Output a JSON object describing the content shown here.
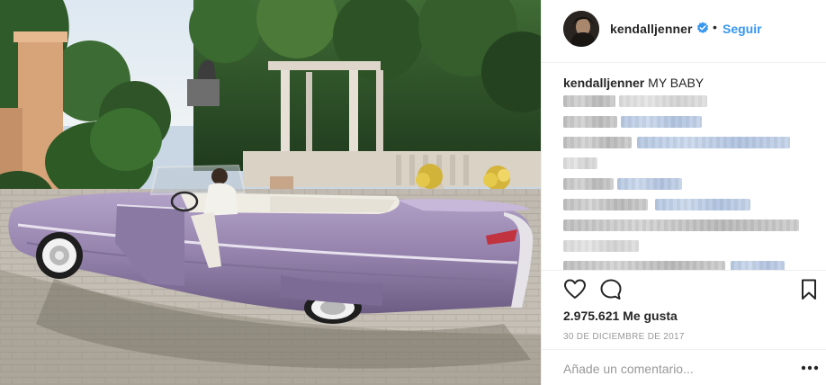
{
  "post": {
    "username": "kendalljenner",
    "verified": true,
    "separator": "•",
    "follow_label": "Seguir",
    "caption_user": "kendalljenner",
    "caption_text": "MY BABY",
    "likes": "2.975.621 Me gusta",
    "date": "30 DE DICIEMBRE DE 2017",
    "comment_placeholder": "Añade un comentario..."
  },
  "icons": {
    "like": "heart-outline-icon",
    "comment": "speech-bubble-icon",
    "save": "bookmark-icon",
    "more": "ellipsis-icon",
    "verified": "verified-badge-icon"
  },
  "colors": {
    "accent": "#3897f0",
    "text": "#262626",
    "muted": "#999999",
    "divider": "#efefef",
    "car": "#9a88b4"
  }
}
